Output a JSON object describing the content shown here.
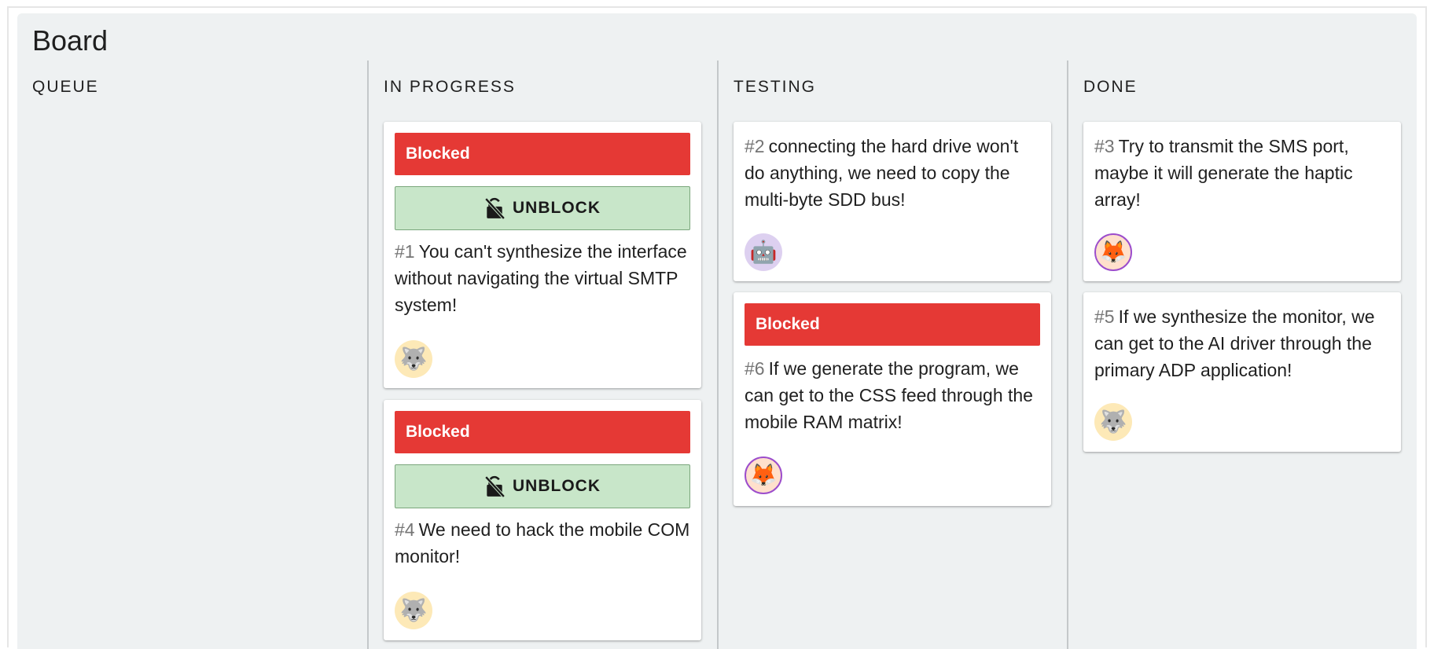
{
  "board": {
    "title": "Board"
  },
  "columns": [
    {
      "title": "QUEUE"
    },
    {
      "title": "IN PROGRESS"
    },
    {
      "title": "TESTING"
    },
    {
      "title": "DONE"
    }
  ],
  "cards": {
    "c1": {
      "blocked_label": "Blocked",
      "unblock_label": "UNBLOCK",
      "number": "#1",
      "text": "You can't synthesize the interface without navigating the virtual SMTP system!",
      "avatar": "🐺",
      "avatar_name": "wolf"
    },
    "c4": {
      "blocked_label": "Blocked",
      "unblock_label": "UNBLOCK",
      "number": "#4",
      "text": "We need to hack the mobile COM monitor!",
      "avatar": "🐺",
      "avatar_name": "wolf"
    },
    "c2": {
      "number": "#2",
      "text": "connecting the hard drive won't do anything, we need to copy the multi-byte SDD bus!",
      "avatar": "🤖",
      "avatar_name": "robot"
    },
    "c6": {
      "blocked_label": "Blocked",
      "number": "#6",
      "text": "If we generate the program, we can get to the CSS feed through the mobile RAM matrix!",
      "avatar": "🦊",
      "avatar_name": "fox"
    },
    "c3": {
      "number": "#3",
      "text": "Try to transmit the SMS port, maybe it will generate the haptic array!",
      "avatar": "🦊",
      "avatar_name": "fox"
    },
    "c5": {
      "number": "#5",
      "text": "If we synthesize the monitor, we can get to the AI driver through the primary ADP application!",
      "avatar": "🐺",
      "avatar_name": "wolf"
    }
  },
  "colors": {
    "blocked": "#e53935",
    "unblock": "#c8e6c9",
    "board_bg": "#eef1f2"
  },
  "icons": {
    "unblock": "lock-off-icon"
  }
}
